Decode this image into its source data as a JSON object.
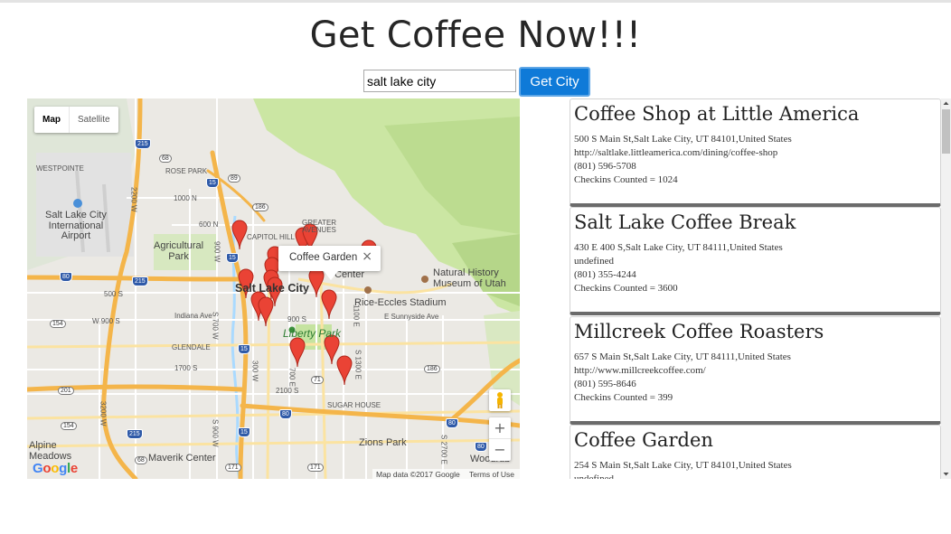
{
  "header": {
    "title": "Get Coffee Now!!!"
  },
  "search": {
    "value": "salt lake city",
    "button_label": "Get City"
  },
  "map": {
    "type_control": {
      "map_label": "Map",
      "satellite_label": "Satellite"
    },
    "info_window": {
      "title": "Coffee Garden",
      "close_glyph": "×"
    },
    "zoom_in": "+",
    "zoom_out": "−",
    "logo": "Google",
    "attribution": {
      "data": "Map data ©2017 Google",
      "terms": "Terms of Use"
    },
    "colors": {
      "water": "#aadaff",
      "park": "#cbe6a3",
      "highway": "#f7c86a",
      "marker": "#ea4335"
    },
    "labels": {
      "westpointe": "WESTPOINTE",
      "rose_park": "ROSE PARK",
      "airport": "Salt Lake City\nInternational\nAirport",
      "agri_park": "Agricultural\nPark",
      "capitol_hill": "CAPITOL HILL",
      "greater_avenues": "GREATER\nAVENUES",
      "slc_downtown": "Salt Lake City",
      "center": "Center",
      "natural_history": "Natural History\nMuseum of Utah",
      "rice_eccles": "Rice-Eccles Stadium",
      "liberty_park": "Liberty Park",
      "glendale": "GLENDALE",
      "sugar_house": "SUGAR HOUSE",
      "zions_park": "Zions Park",
      "maverik_center": "Maverik Center",
      "alpine_meadows": "Alpine\nMeadows",
      "woodruff": "Woodrub",
      "e_sunnyside": "E Sunnyside Ave",
      "indiana_ave": "Indiana Ave",
      "w900s": "W 900 S",
      "s900": "900 S",
      "s500": "500 S",
      "s1700": "1700 S",
      "s2100": "2100 S",
      "n600": "600 N",
      "n1000": "1000 N",
      "w2200": "2200 W",
      "w3200": "3200 W",
      "s1100e": "1100 E",
      "s1300e": "S 1300 E",
      "s2700e": "S 2700 E",
      "w900": "900 W",
      "w300": "300 W",
      "e700": "700 E",
      "w700s": "S 700 W",
      "w900s2": "S 900 W"
    },
    "shields": {
      "i215_a": "215",
      "i215_b": "215",
      "i215_c": "215",
      "i15_a": "15",
      "i15_b": "15",
      "i15_c": "15",
      "i15_d": "15",
      "i80_a": "80",
      "i80_b": "80",
      "i80_c": "80",
      "i80_d": "80",
      "us89": "89",
      "s68_a": "68",
      "s68_b": "68",
      "s186_a": "186",
      "s186_b": "186",
      "s154_a": "154",
      "s154_b": "154",
      "s201": "201",
      "s71": "71",
      "s171_a": "171",
      "s171_b": "171"
    }
  },
  "results": [
    {
      "name": "Coffee Shop at Little America",
      "address": "500 S Main St,Salt Lake City, UT 84101,United States",
      "website": "http://saltlake.littleamerica.com/dining/coffee-shop",
      "phone": "(801) 596-5708",
      "checkins": "Checkins Counted = 1024"
    },
    {
      "name": "Salt Lake Coffee Break",
      "address": "430 E 400 S,Salt Lake City, UT 84111,United States",
      "website": "undefined",
      "phone": "(801) 355-4244",
      "checkins": "Checkins Counted = 3600"
    },
    {
      "name": "Millcreek Coffee Roasters",
      "address": "657 S Main St,Salt Lake City, UT 84111,United States",
      "website": "http://www.millcreekcoffee.com/",
      "phone": "(801) 595-8646",
      "checkins": "Checkins Counted = 399"
    },
    {
      "name": "Coffee Garden",
      "address": "254 S Main St,Salt Lake City, UT 84101,United States",
      "website": "undefined",
      "phone": "",
      "checkins": ""
    }
  ]
}
